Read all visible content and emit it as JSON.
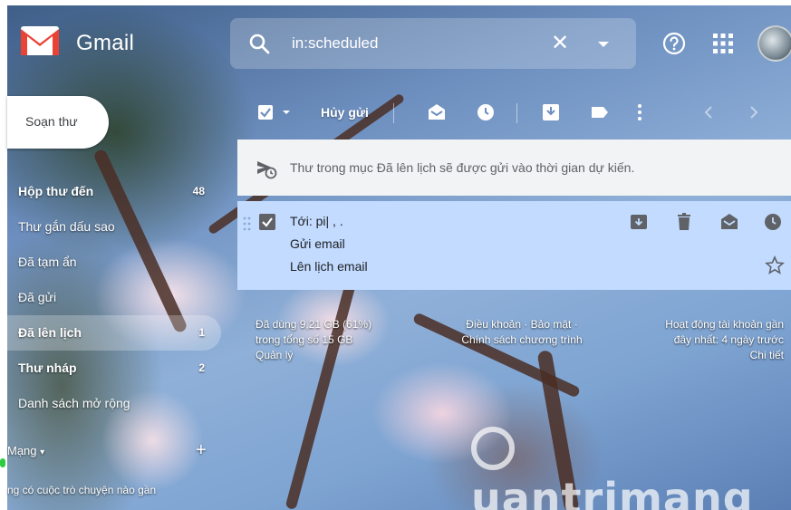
{
  "app": {
    "logo_text": "Gmail"
  },
  "search": {
    "value": "in:scheduled",
    "clear_symbol": "✕"
  },
  "sidebar": {
    "compose_label": "Soạn thư",
    "items": [
      {
        "label": "Hộp thư đến",
        "count": "48"
      },
      {
        "label": "Thư gắn dấu sao",
        "count": ""
      },
      {
        "label": "Đã tạm ẩn",
        "count": ""
      },
      {
        "label": "Đã gửi",
        "count": ""
      },
      {
        "label": "Đã lên lịch",
        "count": "1"
      },
      {
        "label": "Thư nháp",
        "count": "2"
      },
      {
        "label": "Danh sách mở rộng",
        "count": ""
      }
    ],
    "meet_label": "Mạng",
    "meet_add": "+",
    "chat_note": "ng có cuộc trò chuyện nào gần"
  },
  "toolbar": {
    "cancel_send": "Hủy gửi"
  },
  "banner": {
    "message": "Thư trong mục Đã lên lịch sẽ được gửi vào thời gian dự kiến."
  },
  "message": {
    "to": "Tới: pi|  ,  .",
    "subject": "Gửi email",
    "snippet": "Lên lịch email"
  },
  "footer": {
    "storage_line1": "Đã dùng 9,21 GB (61%)",
    "storage_line2": "trong tổng số 15 GB",
    "manage": "Quản lý",
    "terms": "Điều khoản · Bảo mật ·",
    "policy": "Chính sách chương trình",
    "activity_line1": "Hoạt động tài khoản gần",
    "activity_line2": "đây nhất: 4 ngày trước",
    "details": "Chi tiết"
  },
  "watermark": "uantrimang",
  "colors": {
    "selected_row": "#c2dbff",
    "banner_bg": "#f1f3f4",
    "gmail_red": "#ea4335"
  }
}
